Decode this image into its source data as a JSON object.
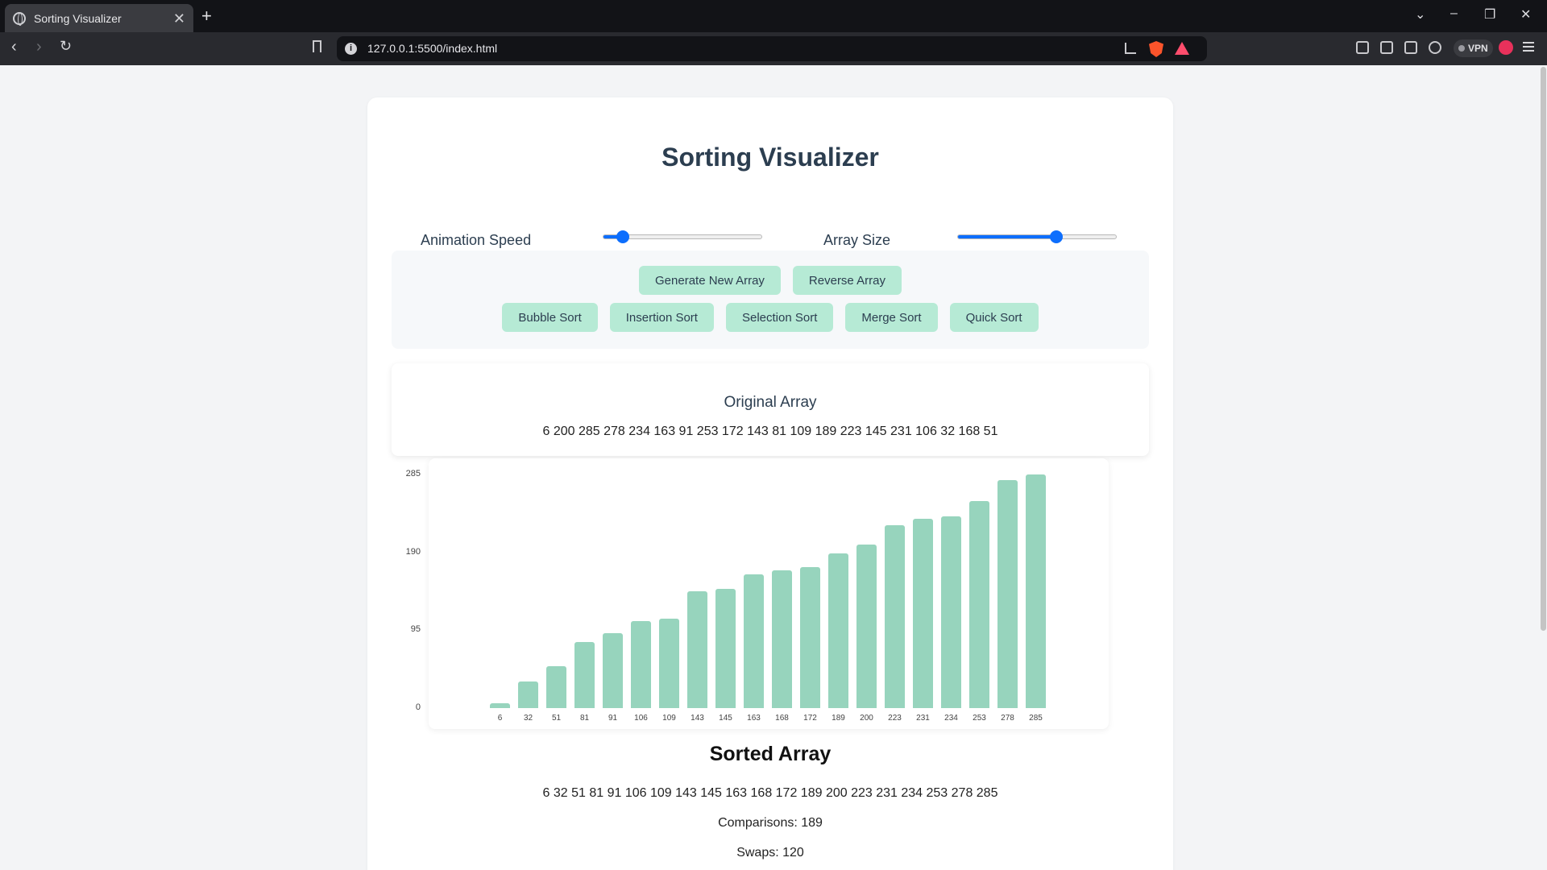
{
  "browser": {
    "tab_title": "Sorting Visualizer",
    "url": "127.0.0.1:5500/index.html",
    "vpn_label": "VPN"
  },
  "page": {
    "title": "Sorting Visualizer",
    "controls": {
      "speed_label": "Animation Speed",
      "speed_value": 0.12,
      "size_label": "Array Size",
      "size_value": 0.62
    },
    "buttons_row1": [
      "Generate New Array",
      "Reverse Array"
    ],
    "buttons_row2": [
      "Bubble Sort",
      "Insertion Sort",
      "Selection Sort",
      "Merge Sort",
      "Quick Sort"
    ],
    "original_title": "Original Array",
    "original_values": "6 200 285 278 234 163 91 253 172 143 81 109 189 223 145 231 106 32 168 51",
    "sorted_title": "Sorted Array",
    "sorted_values": "6 32 51 81 91 106 109 143 145 163 168 172 189 200 223 231 234 253 278 285",
    "comparisons": "Comparisons: 189",
    "swaps": "Swaps: 120"
  },
  "chart_data": {
    "type": "bar",
    "categories": [
      "6",
      "32",
      "51",
      "81",
      "91",
      "106",
      "109",
      "143",
      "145",
      "163",
      "168",
      "172",
      "189",
      "200",
      "223",
      "231",
      "234",
      "253",
      "278",
      "285"
    ],
    "values": [
      6,
      32,
      51,
      81,
      91,
      106,
      109,
      143,
      145,
      163,
      168,
      172,
      189,
      200,
      223,
      231,
      234,
      253,
      278,
      285
    ],
    "ylim": [
      0,
      285
    ],
    "y_ticks": [
      0,
      95,
      190,
      285
    ],
    "bar_color": "#97d4bd"
  }
}
